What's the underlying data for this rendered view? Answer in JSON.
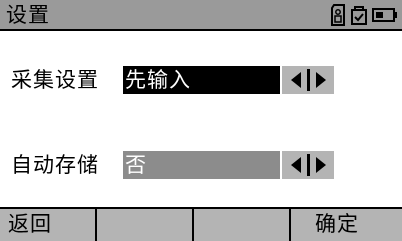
{
  "titlebar": {
    "title": "设置",
    "icons": [
      "sd-card-icon",
      "gps-lock-icon",
      "battery-icon"
    ]
  },
  "settings": [
    {
      "label": "采集设置",
      "value": "先输入",
      "focused": true
    },
    {
      "label": "自动存储",
      "value": "否",
      "focused": false
    }
  ],
  "softkeys": {
    "f1": "返回",
    "f2": "",
    "f3": "",
    "f4": "确定"
  },
  "colors": {
    "titlebar_bg": "#9a9a9a",
    "focused_field_bg": "#000000",
    "normal_field_bg": "#8c8c8c",
    "arrow_bg": "#b4b4b4",
    "softkey_bg": "#b4b4b4"
  }
}
